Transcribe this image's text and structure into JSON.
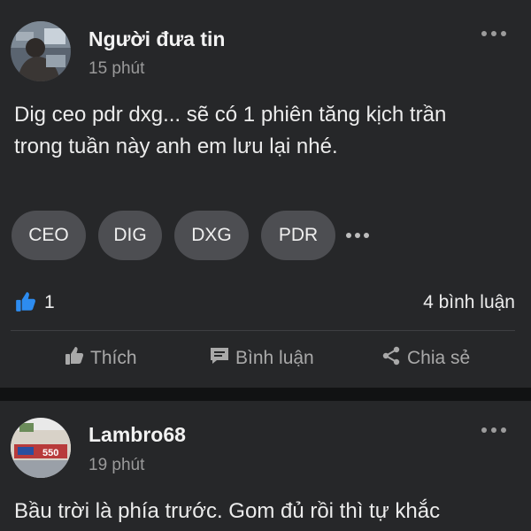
{
  "posts": [
    {
      "author": "Người đưa tin",
      "time": "15 phút",
      "content_lines": [
        "Dig ceo pdr dxg... sẽ có 1 phiên tăng kịch trần",
        "trong tuần này anh em lưu lại nhé."
      ],
      "tags": [
        "CEO",
        "DIG",
        "DXG",
        "PDR"
      ],
      "like_count": "1",
      "comment_count": "4 bình luận",
      "actions": {
        "like": "Thích",
        "comment": "Bình luận",
        "share": "Chia sẻ"
      }
    },
    {
      "author": "Lambro68",
      "time": "19 phút",
      "content_lines": [
        "Bầu trời là phía trước. Gom đủ rồi thì tự khắc"
      ]
    }
  ],
  "colors": {
    "accent": "#2d8cf0",
    "card": "#262729",
    "background": "#111213"
  },
  "icons": [
    "more-icon",
    "thumbs-up-icon",
    "comment-icon",
    "share-icon"
  ]
}
